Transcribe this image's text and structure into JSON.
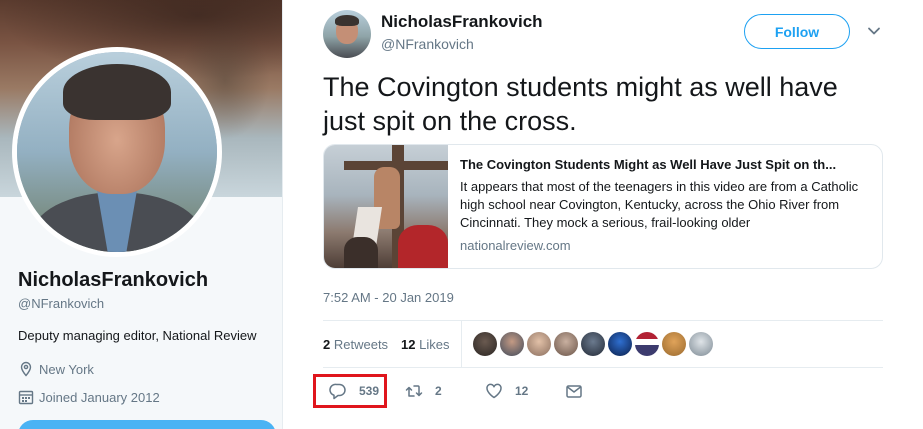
{
  "profile": {
    "name": "NicholasFrankovich",
    "handle": "@NFrankovich",
    "bio": "Deputy managing editor, National Review",
    "location": "New York",
    "joined": "Joined January 2012"
  },
  "tweet": {
    "author_name": "NicholasFrankovich",
    "author_handle": "@NFrankovich",
    "follow_label": "Follow",
    "text": "The Covington students might as well have just spit on the cross.",
    "card": {
      "title": "The Covington Students Might as Well Have Just Spit on th...",
      "description": "It appears that most of the teenagers in this video are from a Catholic high school near Covington, Kentucky, across the Ohio River from Cincinnati. They mock a serious, frail-looking older",
      "domain": "nationalreview.com"
    },
    "timestamp": "7:52 AM - 20 Jan 2019",
    "retweets_count": "2",
    "retweets_label": "Retweets",
    "likes_count": "12",
    "likes_label": "Likes",
    "actions": {
      "reply_count": "539",
      "retweet_count": "2",
      "like_count": "12"
    }
  },
  "colors": {
    "accent": "#1da1f2",
    "highlight": "#e0161d",
    "muted": "#657786"
  },
  "icons": [
    "location-icon",
    "calendar-icon",
    "chevron-down-icon",
    "reply-icon",
    "retweet-icon",
    "heart-icon",
    "message-icon"
  ]
}
